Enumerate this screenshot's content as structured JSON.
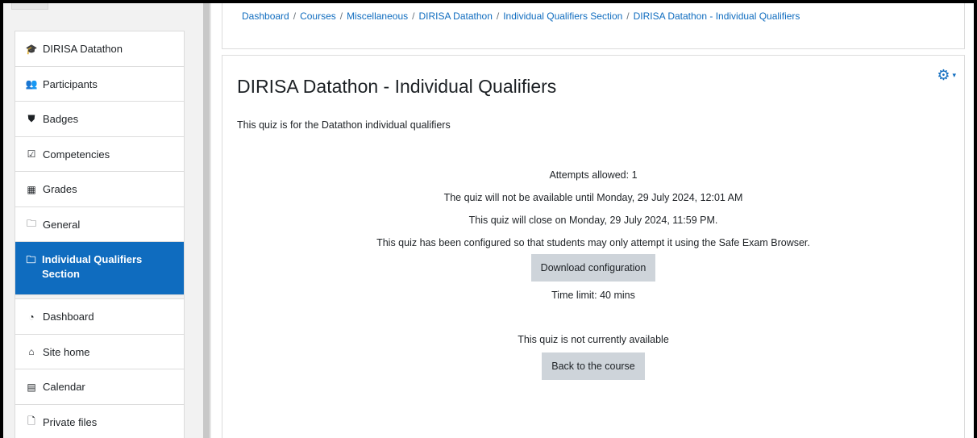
{
  "breadcrumb": [
    "Dashboard",
    "Courses",
    "Miscellaneous",
    "DIRISA Datathon",
    "Individual Qualifiers Section",
    "DIRISA Datathon - Individual Qualifiers"
  ],
  "sidebar": {
    "items": [
      {
        "label": "DIRISA Datathon",
        "icon": "graduation-cap-icon",
        "glyph": "🎓"
      },
      {
        "label": "Participants",
        "icon": "users-icon",
        "glyph": "👥"
      },
      {
        "label": "Badges",
        "icon": "shield-icon",
        "glyph": "⛊"
      },
      {
        "label": "Competencies",
        "icon": "check-square-icon",
        "glyph": "☑"
      },
      {
        "label": "Grades",
        "icon": "table-icon",
        "glyph": "▦"
      },
      {
        "label": "General",
        "icon": "folder-icon",
        "glyph": "🗀"
      },
      {
        "label": "Individual Qualifiers Section",
        "icon": "folder-icon",
        "glyph": "🗀",
        "active": true
      }
    ],
    "items2": [
      {
        "label": "Dashboard",
        "icon": "tachometer-icon",
        "glyph": "◔"
      },
      {
        "label": "Site home",
        "icon": "home-icon",
        "glyph": "⌂"
      },
      {
        "label": "Calendar",
        "icon": "calendar-icon",
        "glyph": "▤"
      },
      {
        "label": "Private files",
        "icon": "file-icon",
        "glyph": "🗋"
      }
    ]
  },
  "main": {
    "title": "DIRISA Datathon - Individual Qualifiers",
    "intro": "This quiz is for the Datathon individual qualifiers",
    "attempts": "Attempts allowed: 1",
    "open_info": "The quiz will not be available until Monday, 29 July 2024, 12:01 AM",
    "close_info": "This quiz will close on Monday, 29 July 2024, 11:59 PM.",
    "seb_info": "This quiz has been configured so that students may only attempt it using the Safe Exam Browser.",
    "download_button": "Download configuration",
    "time_limit": "Time limit: 40 mins",
    "unavailable": "This quiz is not currently available",
    "back_button": "Back to the course",
    "gear_glyph": "⚙",
    "caret_glyph": "▾"
  },
  "colors": {
    "accent": "#0f6cbf",
    "button_bg": "#ced4da"
  }
}
